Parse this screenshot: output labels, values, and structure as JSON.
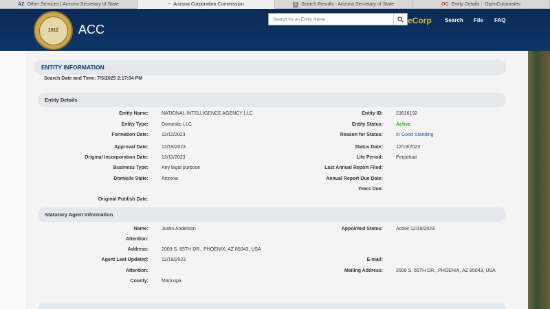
{
  "browser": {
    "tabs": [
      {
        "icon": "AZ",
        "label": "Other Services | Arizona Secretary of State"
      },
      {
        "icon": "~",
        "label": "Arizona Corporation Commission"
      },
      {
        "icon": "A",
        "label": "Search Results - Arizona Secretary of State"
      },
      {
        "icon": "OC",
        "label": "Entity Details :: OpenCorporates"
      }
    ]
  },
  "header": {
    "seal_text": "1912",
    "title": "ACC",
    "search_placeholder": "Search for an Entity Name",
    "ecorp": "eCorp",
    "nav": [
      "Search",
      "File",
      "FAQ"
    ]
  },
  "entity_info": {
    "title": "ENTITY INFORMATION",
    "search_date": "Search Date and Time: 7/5/2025 2:17:04 PM"
  },
  "entity_details": {
    "title": "Entity Details",
    "left": [
      {
        "label": "Entity Name:",
        "value": "NATIONAL INTELLIGENCE AGENCY LLC"
      },
      {
        "label": "Entity Type:",
        "value": "Domestic LLC"
      },
      {
        "label": "Formation Date:",
        "value": "12/11/2023"
      },
      {
        "label": "Approval Date:",
        "value": "12/19/2023"
      },
      {
        "label": "Original Incorporation Date:",
        "value": "12/11/2023"
      },
      {
        "label": "Business Type:",
        "value": "Any legal purpose"
      },
      {
        "label": "Domicile State:",
        "value": "Arizona"
      },
      {
        "label": "Original Publish Date:",
        "value": ""
      }
    ],
    "right": [
      {
        "label": "Entity ID:",
        "value": "23616192"
      },
      {
        "label": "Entity Status:",
        "value": "Active"
      },
      {
        "label": "Reason for Status:",
        "value": "In Good Standing"
      },
      {
        "label": "Status Date:",
        "value": "12/19/2023"
      },
      {
        "label": "Life Period:",
        "value": "Perpetual"
      },
      {
        "label": "Last Annual Report Filed:",
        "value": ""
      },
      {
        "label": "Annual Report Due Date:",
        "value": ""
      },
      {
        "label": "Years Due:",
        "value": ""
      }
    ]
  },
  "statutory_agent": {
    "title": "Statutory Agent Information",
    "left": [
      {
        "label": "Name:",
        "value": "Justin Anderson"
      },
      {
        "label": "Attention:",
        "value": ""
      },
      {
        "label": "Address:",
        "value": "2009 S. 65TH DR., PHOENIX, AZ 85043, USA"
      },
      {
        "label": "Agent Last Updated:",
        "value": "12/19/2023"
      },
      {
        "label": "Attention:",
        "value": ""
      },
      {
        "label": "County:",
        "value": "Maricopa"
      }
    ],
    "right": [
      {
        "label": "Appointed Status:",
        "value": "Active 12/19/2023"
      },
      {
        "label": "E-mail:",
        "value": ""
      },
      {
        "label": "Mailing Address:",
        "value": "2009 S. 65TH DR., PHOENIX, AZ 85043, USA"
      }
    ]
  },
  "colors": {
    "header_bg": "#0e3468",
    "ecorp": "#e2b236",
    "active_status": "#2eaa2e",
    "good_standing": "#1a56a6",
    "section_title": "#0f3a6c"
  }
}
